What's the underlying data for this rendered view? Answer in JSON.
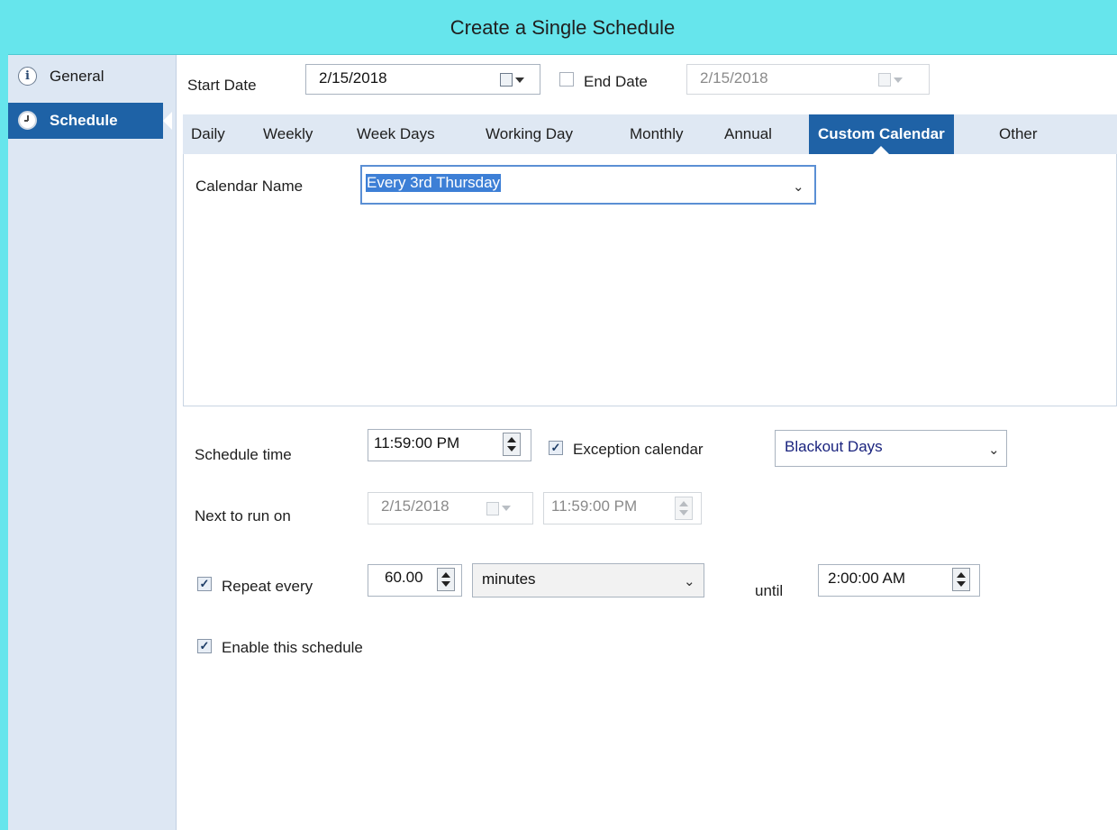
{
  "window": {
    "title": "Create a Single Schedule"
  },
  "sidebar": {
    "items": [
      {
        "label": "General",
        "icon": "info-icon",
        "active": false
      },
      {
        "label": "Schedule",
        "icon": "clock-icon",
        "active": true
      }
    ],
    "scroll_icon": "chevron-down-icon"
  },
  "dates": {
    "start_label": "Start Date",
    "start_value": "2/15/2018",
    "end_label": "End Date",
    "end_checked": false,
    "end_value": "2/15/2018"
  },
  "tabs": [
    {
      "label": "Daily"
    },
    {
      "label": "Weekly"
    },
    {
      "label": "Week Days"
    },
    {
      "label": "Working Day"
    },
    {
      "label": "Monthly"
    },
    {
      "label": "Annual"
    },
    {
      "label": "Custom Calendar",
      "active": true
    },
    {
      "label": "Other"
    }
  ],
  "calendar": {
    "name_label": "Calendar Name",
    "name_value": "Every 3rd Thursday"
  },
  "schedule": {
    "time_label": "Schedule time",
    "time_value": "11:59:00 PM",
    "exception_label": "Exception calendar",
    "exception_checked": true,
    "exception_value": "Blackout Days",
    "next_label": "Next to run on",
    "next_date": "2/15/2018",
    "next_time": "11:59:00 PM",
    "repeat_label": "Repeat every",
    "repeat_checked": true,
    "repeat_value": "60.00",
    "repeat_unit": "minutes",
    "until_label": "until",
    "until_value": "2:00:00 AM",
    "enable_label": "Enable this schedule",
    "enable_checked": true
  },
  "colors": {
    "titlebar": "#66e5ec",
    "sidebar": "#dde7f3",
    "accent": "#1f62a6",
    "selection": "#3d7fd6",
    "exception_text": "#1a237e"
  }
}
